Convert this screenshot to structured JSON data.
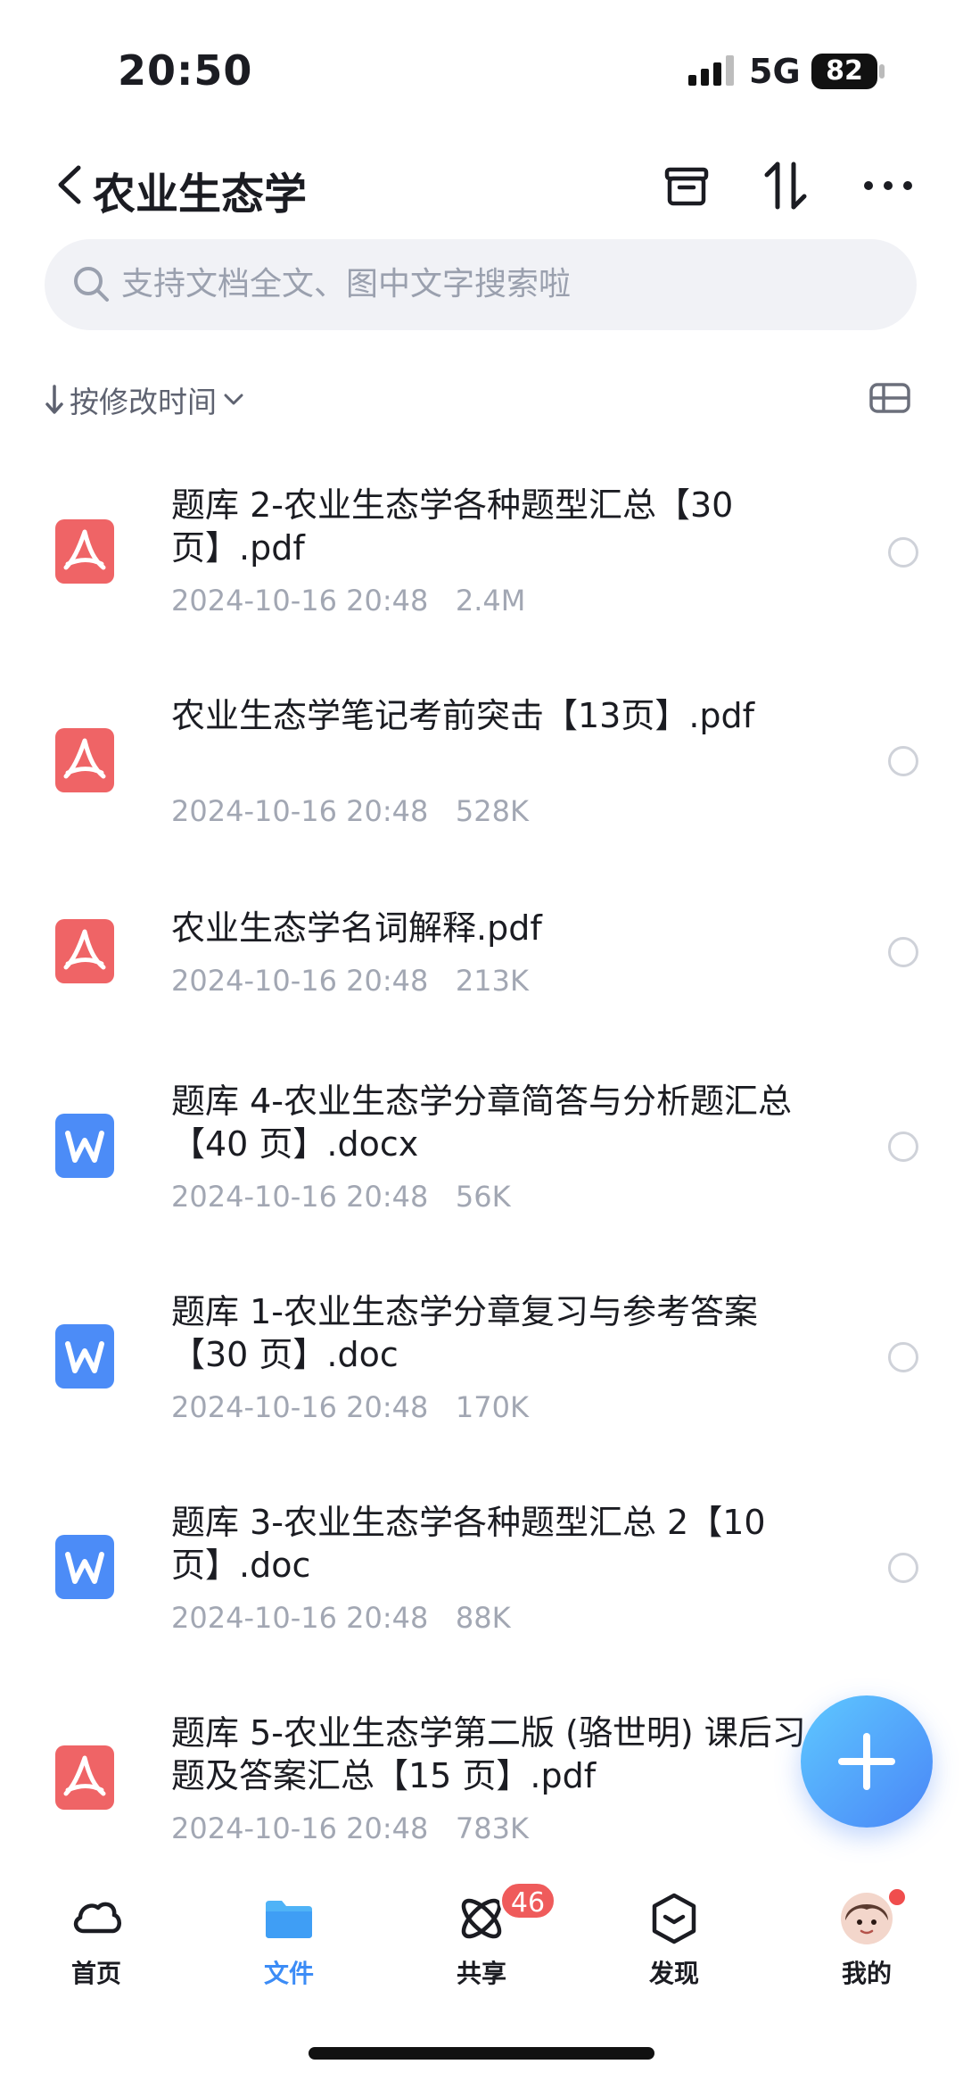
{
  "status_bar": {
    "time": "20:50",
    "network": "5G",
    "battery": "82"
  },
  "header": {
    "title": "农业生态学"
  },
  "search": {
    "placeholder": "支持文档全文、图中文字搜索啦"
  },
  "sort": {
    "label": "按修改时间"
  },
  "files": [
    {
      "type": "pdf",
      "name": "题库 2-农业生态学各种题型汇总【30页】.pdf",
      "date": "2024-10-16 20:48",
      "size": "2.4M"
    },
    {
      "type": "pdf",
      "name": "农业生态学笔记考前突击【13页】.pdf",
      "date": "2024-10-16 20:48",
      "size": "528K"
    },
    {
      "type": "pdf",
      "name": "农业生态学名词解释.pdf",
      "date": "2024-10-16 20:48",
      "size": "213K"
    },
    {
      "type": "word",
      "name": "题库 4-农业生态学分章简答与分析题汇总【40 页】.docx",
      "date": "2024-10-16 20:48",
      "size": "56K"
    },
    {
      "type": "word",
      "name": "题库 1-农业生态学分章复习与参考答案【30 页】.doc",
      "date": "2024-10-16 20:48",
      "size": "170K"
    },
    {
      "type": "word",
      "name": "题库 3-农业生态学各种题型汇总 2【10 页】.doc",
      "date": "2024-10-16 20:48",
      "size": "88K"
    },
    {
      "type": "pdf",
      "name": "题库 5-农业生态学第二版 (骆世明) 课后习题及答案汇总【15 页】.pdf",
      "date": "2024-10-16 20:48",
      "size": "783K"
    }
  ],
  "nav": {
    "items": [
      {
        "label": "首页",
        "icon": "cloud-icon"
      },
      {
        "label": "文件",
        "icon": "folder-icon",
        "active": true
      },
      {
        "label": "共享",
        "icon": "share-icon",
        "badge": "46"
      },
      {
        "label": "发现",
        "icon": "discover-icon"
      },
      {
        "label": "我的",
        "icon": "avatar-icon"
      }
    ]
  },
  "colors": {
    "accent": "#3c8cf6",
    "pdf": "#ef6466",
    "word": "#4c8cf7",
    "badge": "#ef5b5b"
  }
}
